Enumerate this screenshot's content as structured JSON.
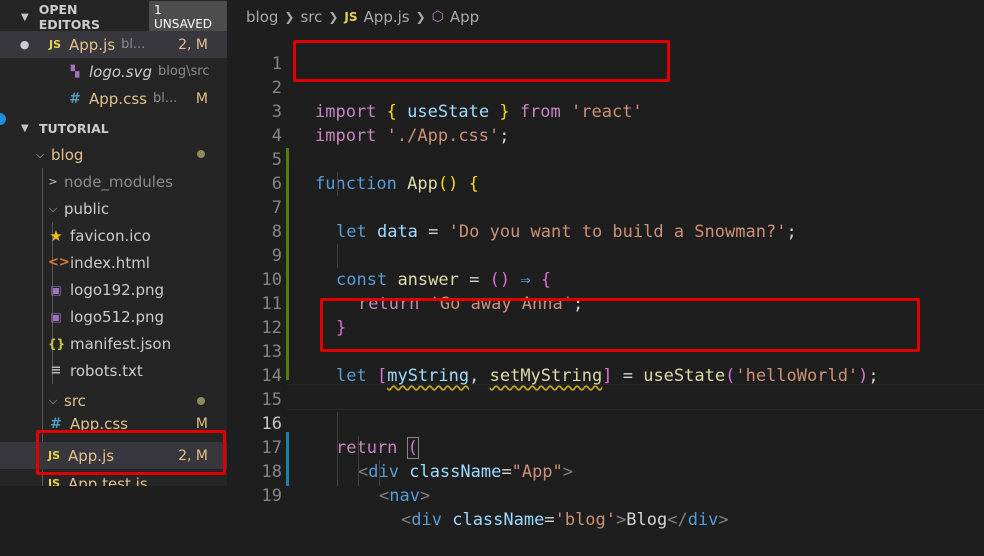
{
  "sidebar": {
    "open_editors": {
      "title": "OPEN EDITORS",
      "badge": "1 UNSAVED",
      "items": [
        {
          "icon": "JS",
          "name": "App.js",
          "path": "bl...",
          "status": "2, M"
        },
        {
          "icon": "svg",
          "name": "logo.svg",
          "path": "blog\\src",
          "status": ""
        },
        {
          "icon": "#",
          "name": "App.css",
          "path": "bl...",
          "status": "M"
        }
      ]
    },
    "tutorial": {
      "title": "TUTORIAL",
      "tree": [
        {
          "name": "blog",
          "twisty": "⌵"
        },
        {
          "name": "node_modules",
          "twisty": ">"
        },
        {
          "name": "public",
          "twisty": "⌵"
        },
        {
          "name": "favicon.ico",
          "icon": "★"
        },
        {
          "name": "index.html",
          "icon": "<>"
        },
        {
          "name": "logo192.png",
          "icon": "▣"
        },
        {
          "name": "logo512.png",
          "icon": "▣"
        },
        {
          "name": "manifest.json",
          "icon": "{}"
        },
        {
          "name": "robots.txt",
          "icon": "≡"
        },
        {
          "name": "src",
          "twisty": "⌵"
        },
        {
          "name": "App.css",
          "icon": "#",
          "status": "M"
        },
        {
          "name": "App.js",
          "icon": "JS",
          "status": "2, M"
        },
        {
          "name": "App.test.js",
          "icon": "JS"
        }
      ]
    }
  },
  "breadcrumb": {
    "parts": [
      "blog",
      "src",
      "App.js",
      "App"
    ],
    "js_badge": "JS"
  },
  "code": {
    "lines": [
      {
        "n": "1"
      },
      {
        "n": "2"
      },
      {
        "n": "3"
      },
      {
        "n": "4"
      },
      {
        "n": "5"
      },
      {
        "n": "6"
      },
      {
        "n": "7"
      },
      {
        "n": "8"
      },
      {
        "n": "9"
      },
      {
        "n": "10"
      },
      {
        "n": "11"
      },
      {
        "n": "12"
      },
      {
        "n": "13"
      },
      {
        "n": "14"
      },
      {
        "n": "15"
      },
      {
        "n": "16"
      },
      {
        "n": "17"
      },
      {
        "n": "18"
      },
      {
        "n": "19"
      }
    ],
    "t": {
      "import": "import",
      "from": "from",
      "useState": "useState",
      "react_str": "'react'",
      "app_css_str": "'./App.css'",
      "function": "function",
      "App": "App",
      "let": "let",
      "data": "data",
      "snowman_str": "'Do you want to build a Snowman?'",
      "const": "const",
      "answer": "answer",
      "arrow": "⇒",
      "return": "return",
      "anna_str": "'Go away Anna'",
      "myString": "myString",
      "setMyString": "setMyString",
      "hello_str": "'helloWorld'",
      "div": "div",
      "className": "className",
      "app_attr": "\"App\"",
      "nav": "nav",
      "blog_attr": "'blog'",
      "blog_text": "Blog"
    }
  },
  "colors": {
    "highlight_box": "#e00000",
    "modified": "#e2c08d"
  }
}
